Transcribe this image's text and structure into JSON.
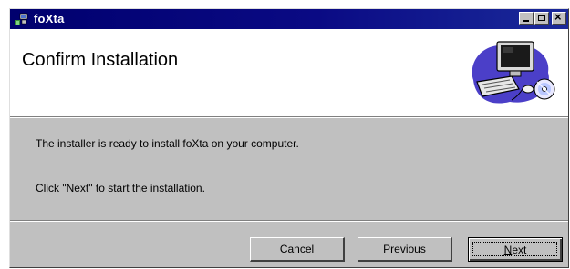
{
  "window": {
    "title": "foXta",
    "controls": {
      "minimize": "minimize-icon",
      "maximize": "maximize-icon",
      "close": "close-icon"
    }
  },
  "banner": {
    "title": "Confirm Installation",
    "icon": "computer-install-icon"
  },
  "body": {
    "ready_text": "The installer is ready to install foXta on your computer.",
    "click_text": "Click \"Next\" to start the installation."
  },
  "buttons": {
    "cancel": {
      "first": "C",
      "rest": "ancel"
    },
    "previous": {
      "first": "P",
      "rest": "revious"
    },
    "next": {
      "first": "N",
      "rest": "ext"
    }
  },
  "colors": {
    "titlebar": "#00006e",
    "face": "#c0c0c0",
    "banner": "#ffffff"
  }
}
